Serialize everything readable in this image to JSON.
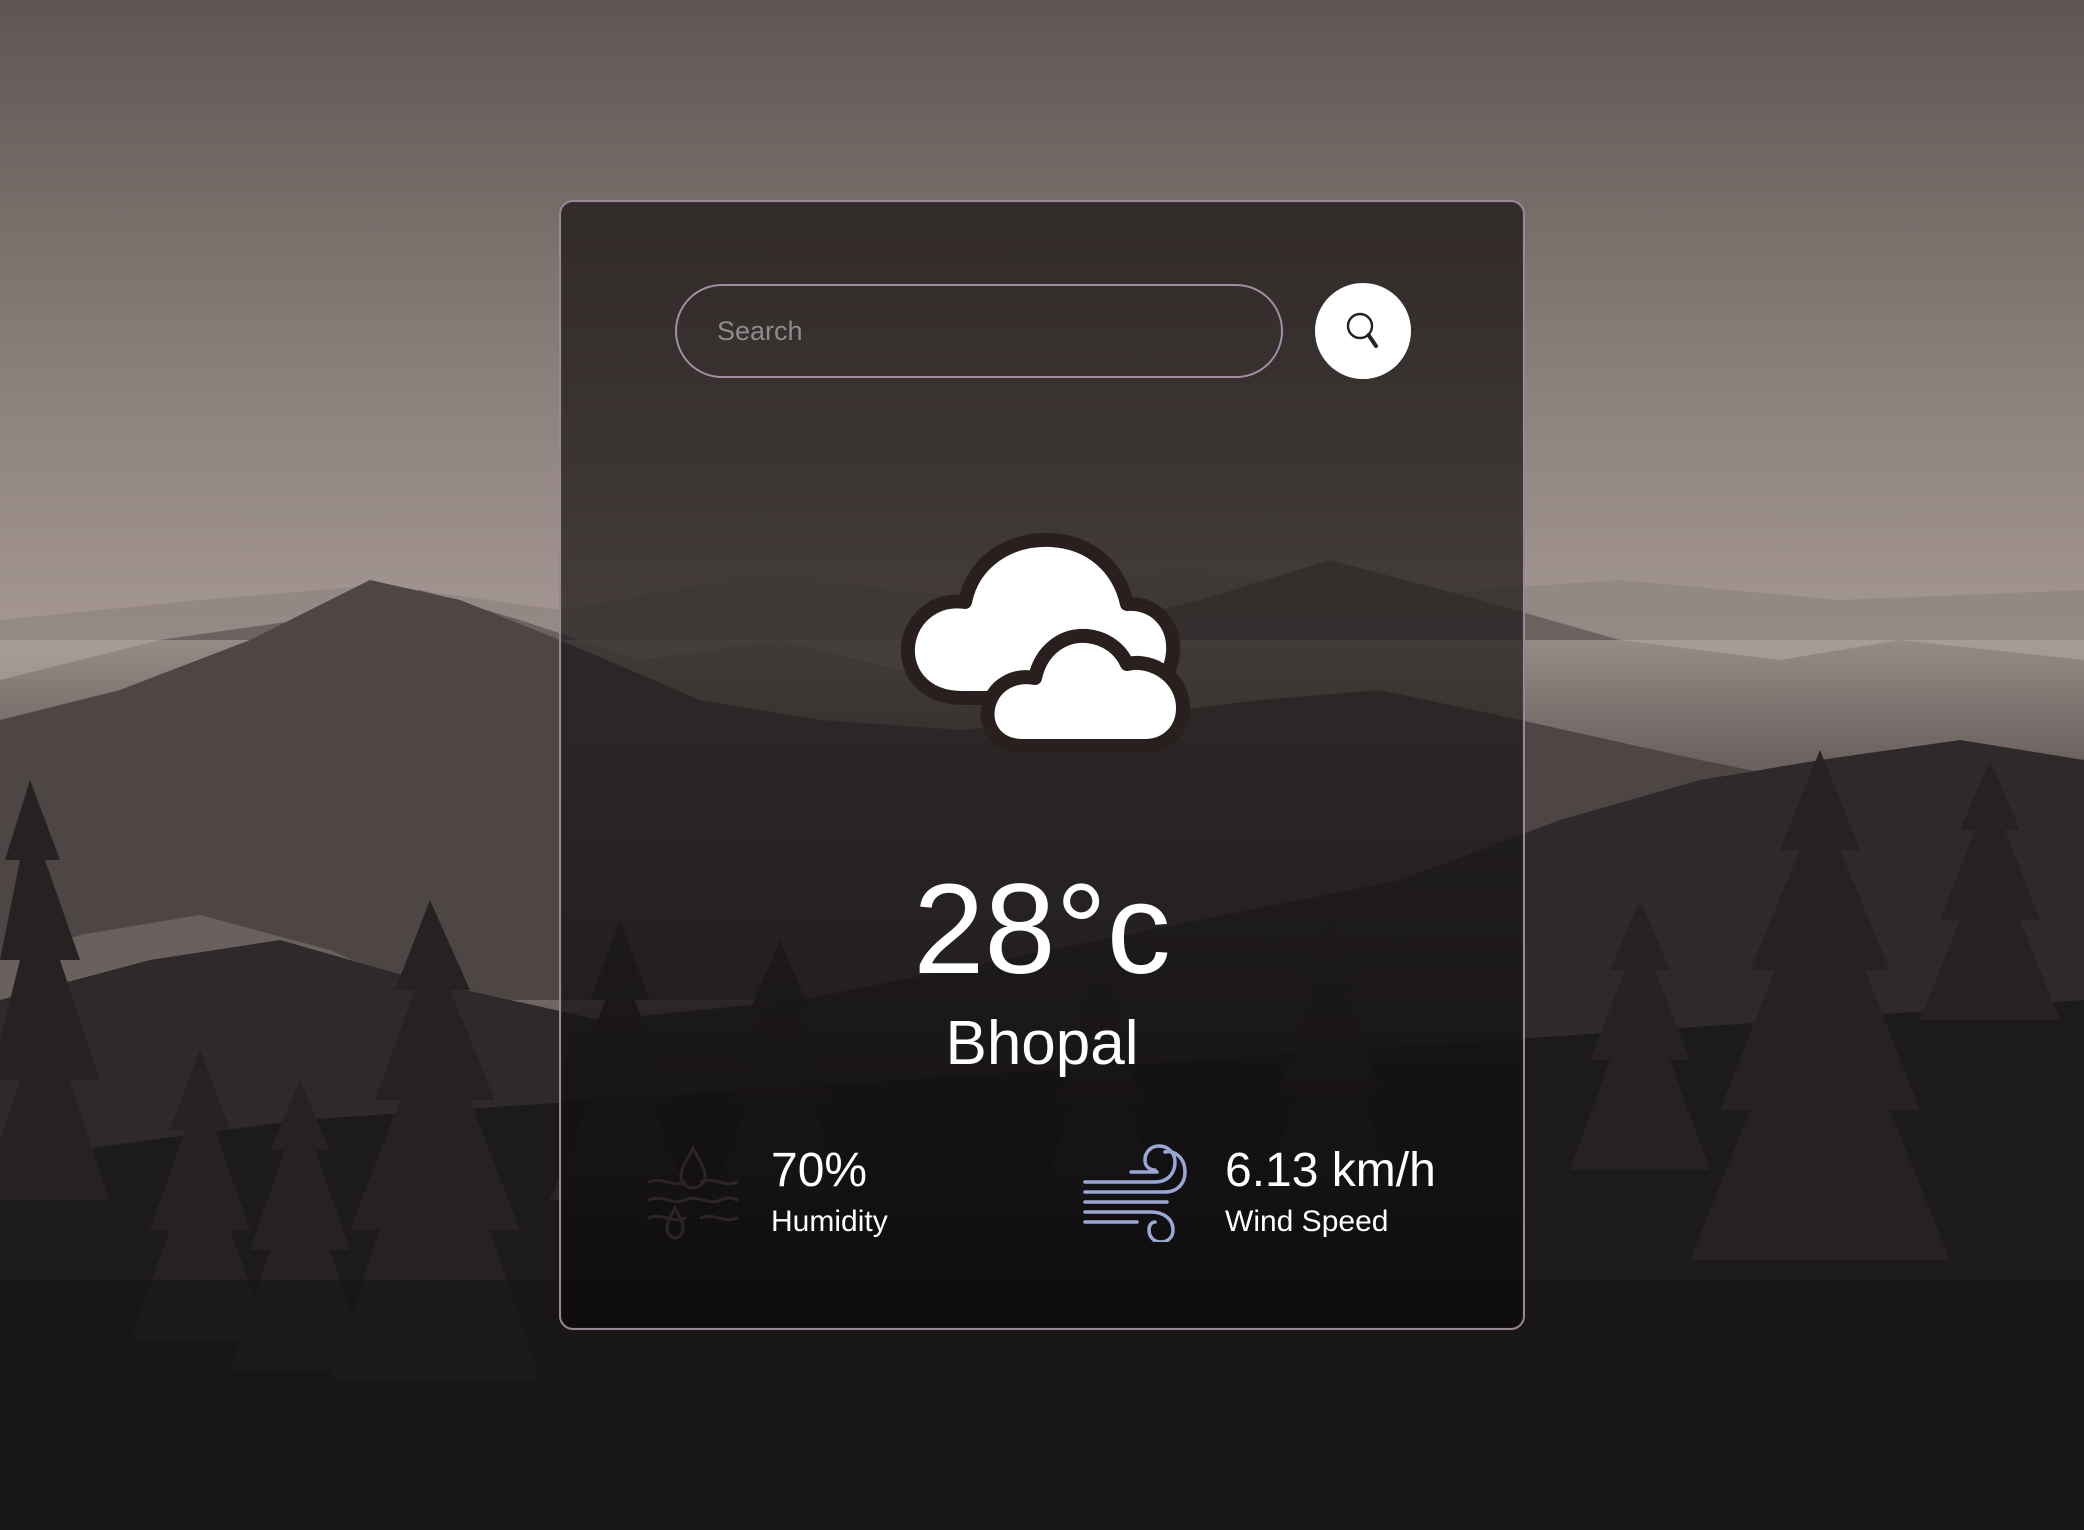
{
  "search": {
    "placeholder": "Search",
    "value": ""
  },
  "weather": {
    "condition_icon": "clouds-icon",
    "temperature": "28°c",
    "city": "Bhopal"
  },
  "details": {
    "humidity": {
      "icon": "humidity-icon",
      "value": "70%",
      "label": "Humidity"
    },
    "wind": {
      "icon": "wind-icon",
      "value": "6.13 km/h",
      "label": "Wind Speed"
    }
  },
  "colors": {
    "card_border": "#9a8696",
    "search_border": "#a38ea4",
    "wind_icon": "#9aa6d6",
    "text": "#ffffff"
  }
}
